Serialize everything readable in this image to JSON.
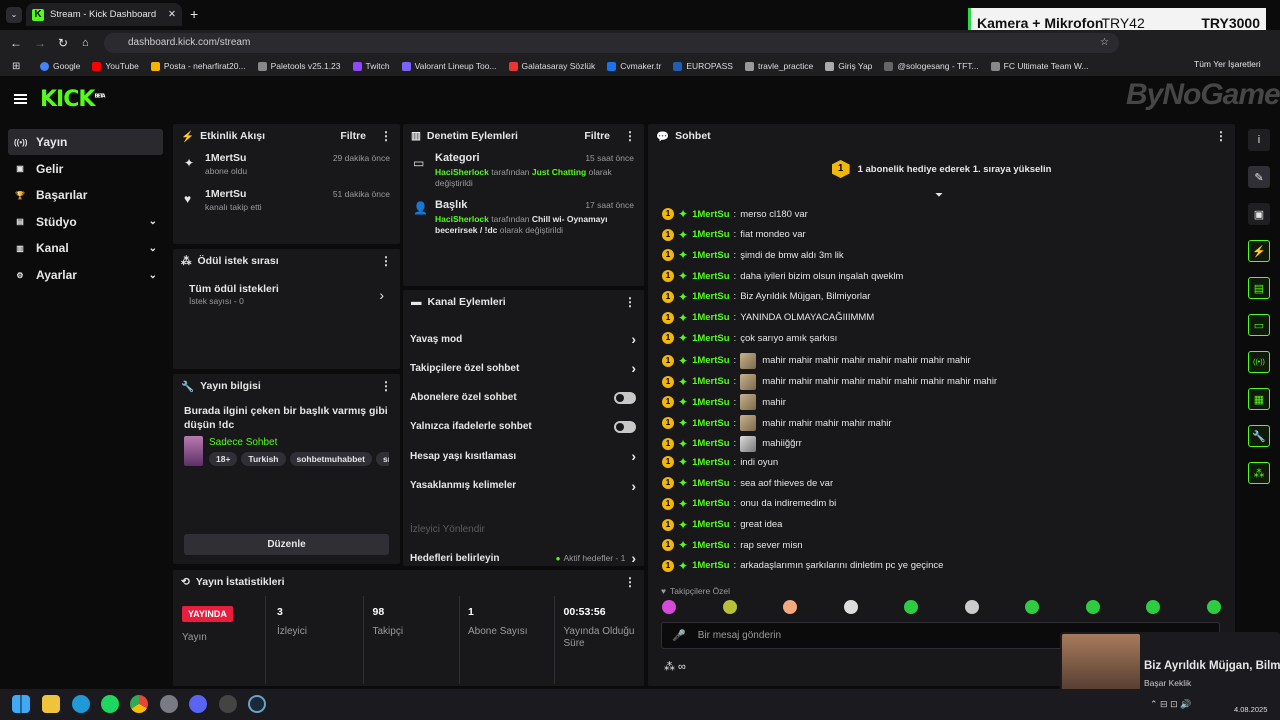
{
  "browser": {
    "tab_title": "Stream - Kick Dashboard",
    "url": "dashboard.kick.com/stream",
    "bookmarks": [
      "Google",
      "YouTube",
      "Posta - neharfirat20...",
      "Paletools v25.1.23",
      "Twitch",
      "Valorant Lineup Too...",
      "Galatasaray Sözlük",
      "Cvmaker.tr",
      "EUROPASS",
      "travle_practice",
      "Giriş Yap",
      "@sologesang - TFT...",
      "FC Ultimate Team W..."
    ],
    "bookmarks_more": "Tüm Yer İşaretleri"
  },
  "overlay": {
    "label": "Kamera + Mikrofon",
    "code1": "TRY42",
    "code2": "TRY3000"
  },
  "app": {
    "logo": "KICK",
    "logo_badge": "BETA",
    "watermark": "ByNoGame"
  },
  "sidebar": {
    "items": [
      {
        "label": "Yayın",
        "icon": "broadcast-icon",
        "active": true
      },
      {
        "label": "Gelir",
        "icon": "wallet-icon"
      },
      {
        "label": "Başarılar",
        "icon": "trophy-icon"
      },
      {
        "label": "Stüdyo",
        "icon": "studio-icon",
        "expand": true
      },
      {
        "label": "Kanal",
        "icon": "channel-icon",
        "expand": true
      },
      {
        "label": "Ayarlar",
        "icon": "gear-icon",
        "expand": true
      }
    ]
  },
  "activity": {
    "title": "Etkinlik Akışı",
    "filter": "Filtre",
    "items": [
      {
        "user": "1MertSu",
        "action": "abone oldu",
        "time": "29 dakika önce"
      },
      {
        "user": "1MertSu",
        "action": "kanalı takip etti",
        "time": "51 dakika önce"
      }
    ]
  },
  "moderation": {
    "title": "Denetim Eylemleri",
    "filter": "Filtre",
    "items": [
      {
        "title": "Kategori",
        "time": "15 saat önce",
        "by": "HaciSherlock",
        "mid": "tarafından",
        "value": "Just Chatting",
        "tail": "olarak",
        "line2": "değiştirildi"
      },
      {
        "title": "Başlık",
        "time": "17 saat önce",
        "by": "HaciSherlock",
        "mid": "tarafından",
        "value": "Chill wi- Oynamayı",
        "tail": "",
        "line2b": "becerirsek / !dc",
        "line2": "olarak değiştirildi"
      }
    ]
  },
  "rewards": {
    "title": "Ödül istek sırası",
    "all": "Tüm ödül istekleri",
    "count": "İstek sayısı - 0"
  },
  "channel_actions": {
    "title": "Kanal Eylemleri",
    "items": [
      "Yavaş mod",
      "Takipçilere özel sohbet",
      "Abonelere özel sohbet",
      "Yalnızca ifadelerle sohbet",
      "Hesap yaşı kısıtlaması",
      "Yasaklanmış kelimeler"
    ],
    "disabled": "İzleyici Yönlendir",
    "goals": "Hedefleri belirleyin",
    "goals_status": "Aktif hedefler - 1"
  },
  "stream_info": {
    "title": "Yayın bilgisi",
    "stream_title": "Burada ilgini çeken bir başlık varmış gibi düşün !dc",
    "category": "Sadece Sohbet",
    "tags": [
      "18+",
      "Turkish",
      "sohbetmuhabbet",
      "sıkıl"
    ],
    "edit": "Düzenle"
  },
  "stats": {
    "title": "Yayın İstatistikleri",
    "live_badge": "YAYINDA",
    "live_label": "Yayın",
    "items": [
      {
        "value": "3",
        "label": "İzleyici"
      },
      {
        "value": "98",
        "label": "Takipçi"
      },
      {
        "value": "1",
        "label": "Abone Sayısı"
      },
      {
        "value": "00:53:56",
        "label": "Yayında Olduğu Süre"
      }
    ]
  },
  "chat": {
    "title": "Sohbet",
    "pinned": "1 abonelik hediye ederek 1. sıraya yükselin",
    "pinned_badge": "1",
    "messages": [
      {
        "user": "1MertSu",
        "text": "merso cl180 var"
      },
      {
        "user": "1MertSu",
        "text": "fiat mondeo var"
      },
      {
        "user": "1MertSu",
        "text": "şimdi de bmw aldı 3m lik"
      },
      {
        "user": "1MertSu",
        "text": "daha iyileri bizim olsun inşalah qweklm"
      },
      {
        "user": "1MertSu",
        "text": "Biz Ayrıldık Müjgan, Bilmiyorlar"
      },
      {
        "user": "1MertSu",
        "text": "YANINDA OLMAYACAĞIIIMMM"
      },
      {
        "user": "1MertSu",
        "text": "çok sarıyo amık şarkısı"
      },
      {
        "user": "1MertSu",
        "text": "mahir mahir mahir mahir mahir mahir mahir mahir"
      },
      {
        "user": "1MertSu",
        "text": "mahir mahir mahir mahir mahir mahir mahir mahir mahir"
      },
      {
        "user": "1MertSu",
        "text": "mahir"
      },
      {
        "user": "1MertSu",
        "text": "mahir mahir mahir mahir mahir"
      },
      {
        "user": "1MertSu",
        "text": "mahiiğğrr"
      },
      {
        "user": "1MertSu",
        "text": "indi oyun"
      },
      {
        "user": "1MertSu",
        "text": "sea aof thieves de var"
      },
      {
        "user": "1MertSu",
        "text": "onuı da indiremedim bi"
      },
      {
        "user": "1MertSu",
        "text": "great idea"
      },
      {
        "user": "1MertSu",
        "text": "rap sever misn"
      },
      {
        "user": "1MertSu",
        "text": "arkadaşlarımın şarkılarını dinletim pc ye geçince"
      }
    ],
    "mode": "Takipçilere Özel",
    "placeholder": "Bir mesaj gönderin"
  },
  "music": {
    "title": "Biz Ayrıldık Müjgan, Bilmi",
    "artist": "Başar Keklik"
  },
  "clock": {
    "date": "4.08.2025"
  },
  "colors": {
    "accent": "#53fc18",
    "panel": "#18181b",
    "bg": "#0b0b0c",
    "live": "#e91e3f"
  }
}
